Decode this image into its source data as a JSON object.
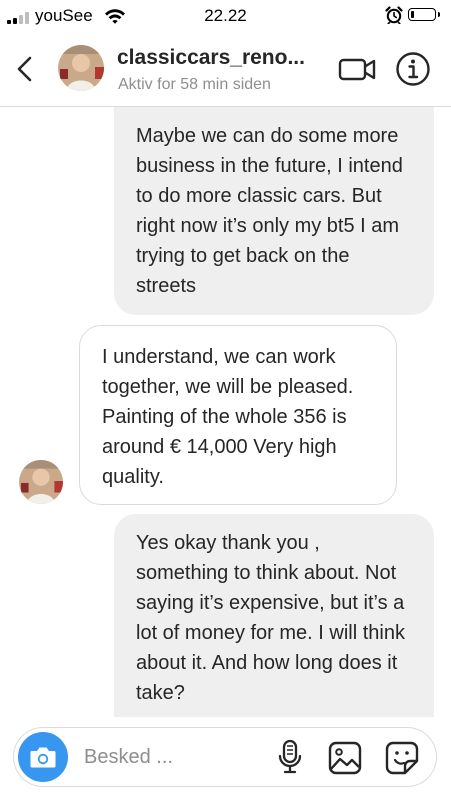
{
  "status_bar": {
    "carrier": "youSee",
    "time": "22.22",
    "signal_bars_active": 2,
    "battery_level": 0.12,
    "icons": [
      "signal-icon",
      "wifi-icon",
      "alarm-icon",
      "battery-icon"
    ]
  },
  "header": {
    "contact_name": "classiccars_reno...",
    "status": "Aktiv for 58 min siden",
    "icons": [
      "back-arrow-icon",
      "video-call-icon",
      "info-icon"
    ]
  },
  "messages": [
    {
      "direction": "sent",
      "text": "Maybe we can do some more business in the future, I intend to do more classic cars. But right now it’s only my bt5 I am trying to get back on the streets"
    },
    {
      "direction": "received",
      "text": "I understand, we can work together, we will be pleased. Painting of the whole 356 is around € 14,000 Very high quality."
    },
    {
      "direction": "sent",
      "text": "Yes okay thank you , something to think about. Not saying it’s expensive, but it’s a lot of money for me. I will think about it. And how long does it take?"
    }
  ],
  "composer": {
    "placeholder": "Besked ...",
    "value": "",
    "icons": [
      "camera-icon",
      "microphone-icon",
      "gallery-icon",
      "sticker-icon"
    ]
  },
  "colors": {
    "accent": "#3797f0",
    "sent_bubble": "#efefef",
    "received_border": "#dbdbdb",
    "secondary_text": "#8e8e8e"
  }
}
